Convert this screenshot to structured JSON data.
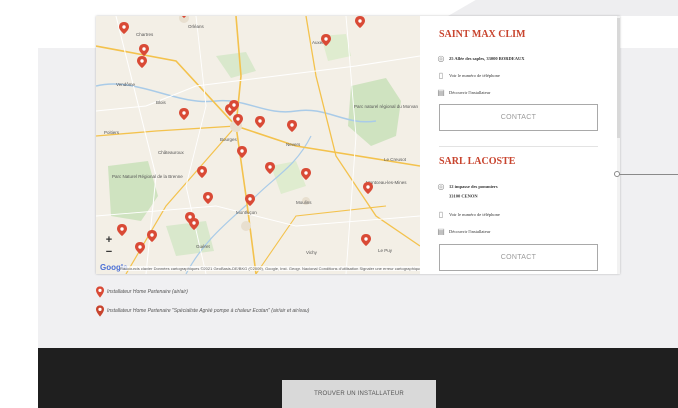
{
  "map": {
    "zoom_in": "+",
    "zoom_out": "−",
    "google_label": "Google",
    "attribution": "Raccourcis clavier   Données cartographiques ©2021 GeoBasis-DE/BKG (©2009), Google, Inst. Geogr. Nacional   Conditions d'utilisation   Signaler une erreur cartographique",
    "pin_color": "#d94a36",
    "place_labels": [
      "Orléans",
      "Chartres",
      "Vendôme",
      "Blois",
      "Bourges",
      "Nevers",
      "Le Creusot",
      "Montceau-les-Mines",
      "Moulins",
      "Montluçon",
      "Châteauroux",
      "Guéret",
      "Poitiers",
      "Vichy",
      "Parc naturel régional du Morvan",
      "Parc Naturel Régional de la Brenne",
      "Auxerre",
      "Le Puy"
    ]
  },
  "installers": [
    {
      "name": "SAINT MAX CLIM",
      "address_line1": "25 Allée des saples, 33000 BORDEAUX",
      "address_line2": "",
      "phone_link": "Voir le numéro de téléphone",
      "discover_link": "Découvrir l'installateur",
      "contact_label": "CONTACT"
    },
    {
      "name": "SARL LACOSTE",
      "address_line1": "12 impasse des pommiers",
      "address_line2": "33100 CENON",
      "phone_link": "Voir le numéro de téléphone",
      "discover_link": "Découvrir l'installateur",
      "contact_label": "CONTACT"
    }
  ],
  "legend": [
    {
      "text": "Installateur Home Partenaire (air/air)"
    },
    {
      "text": "Installateur Home Partenaire \"Spécialiste Agréé pompe à chaleur Ecotan\" (air/air et air/eau)"
    }
  ],
  "footer": {
    "find_button": "TROUVER UN INSTALLATEUR"
  },
  "colors": {
    "accent": "#c8442e",
    "dark_band": "#1f1f1f",
    "grey_band": "#f0f0f2"
  }
}
